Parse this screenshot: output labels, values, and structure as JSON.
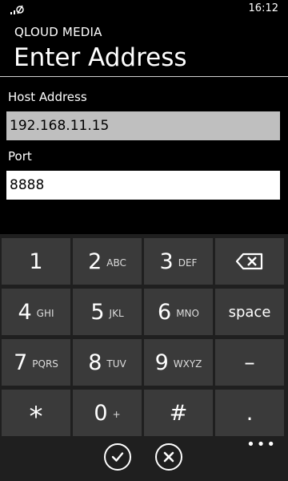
{
  "status_bar": {
    "time": "16:12"
  },
  "header": {
    "app_name": "QLOUD MEDIA",
    "title": "Enter Address"
  },
  "form": {
    "host_label": "Host Address",
    "host_value": "192.168.11.15",
    "port_label": "Port",
    "port_value": "8888"
  },
  "keyboard": {
    "keys": [
      {
        "num": "1",
        "letters": ""
      },
      {
        "num": "2",
        "letters": "ABC"
      },
      {
        "num": "3",
        "letters": "DEF"
      },
      {
        "num": "4",
        "letters": "GHI"
      },
      {
        "num": "5",
        "letters": "JKL"
      },
      {
        "num": "6",
        "letters": "MNO"
      },
      {
        "num": "7",
        "letters": "PQRS"
      },
      {
        "num": "8",
        "letters": "TUV"
      },
      {
        "num": "9",
        "letters": "WXYZ"
      },
      {
        "num": "*",
        "letters": ""
      },
      {
        "num": "0",
        "letters": "+"
      },
      {
        "num": "#",
        "letters": ""
      }
    ],
    "space_label": "space",
    "minus_label": "–",
    "dot_label": "."
  },
  "appbar": {
    "more_label": "•••"
  },
  "icons": {
    "signal": "signal-icon",
    "backspace": "backspace-icon",
    "check": "check-icon",
    "cancel": "cancel-icon"
  }
}
